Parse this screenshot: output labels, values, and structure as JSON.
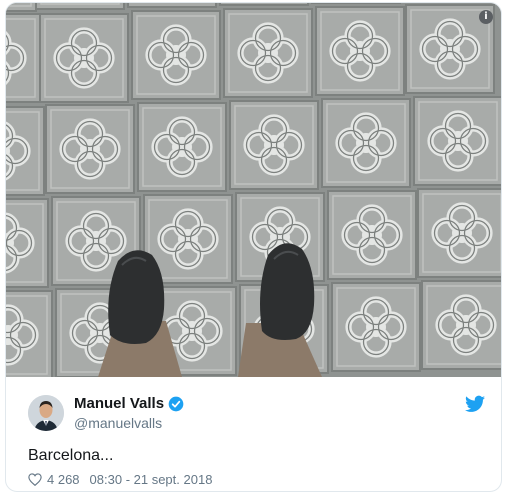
{
  "tweet": {
    "author_name": "Manuel Valls",
    "handle": "@manuelvalls",
    "text": "Barcelona...",
    "like_count": "4 268",
    "timestamp": "08:30 - 21 sept. 2018"
  },
  "icons": {
    "info": "info-icon",
    "verified": "verified-badge-icon",
    "brand": "twitter-bird-icon",
    "like": "heart-icon"
  },
  "colors": {
    "brand_blue": "#1da1f2",
    "text_primary": "#14171a",
    "text_secondary": "#657786",
    "border": "#e1e8ed"
  }
}
